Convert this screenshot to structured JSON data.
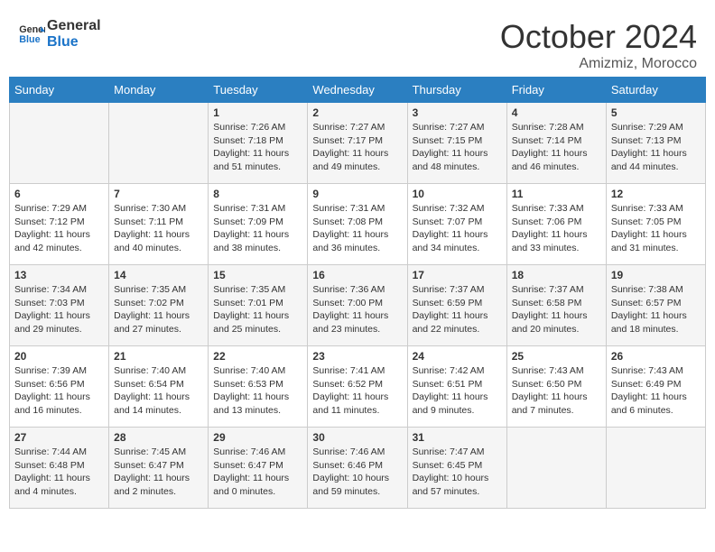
{
  "header": {
    "logo_line1": "General",
    "logo_line2": "Blue",
    "month_title": "October 2024",
    "subtitle": "Amizmiz, Morocco"
  },
  "days_of_week": [
    "Sunday",
    "Monday",
    "Tuesday",
    "Wednesday",
    "Thursday",
    "Friday",
    "Saturday"
  ],
  "weeks": [
    [
      {
        "day": "",
        "sunrise": "",
        "sunset": "",
        "daylight": ""
      },
      {
        "day": "",
        "sunrise": "",
        "sunset": "",
        "daylight": ""
      },
      {
        "day": "1",
        "sunrise": "Sunrise: 7:26 AM",
        "sunset": "Sunset: 7:18 PM",
        "daylight": "Daylight: 11 hours and 51 minutes."
      },
      {
        "day": "2",
        "sunrise": "Sunrise: 7:27 AM",
        "sunset": "Sunset: 7:17 PM",
        "daylight": "Daylight: 11 hours and 49 minutes."
      },
      {
        "day": "3",
        "sunrise": "Sunrise: 7:27 AM",
        "sunset": "Sunset: 7:15 PM",
        "daylight": "Daylight: 11 hours and 48 minutes."
      },
      {
        "day": "4",
        "sunrise": "Sunrise: 7:28 AM",
        "sunset": "Sunset: 7:14 PM",
        "daylight": "Daylight: 11 hours and 46 minutes."
      },
      {
        "day": "5",
        "sunrise": "Sunrise: 7:29 AM",
        "sunset": "Sunset: 7:13 PM",
        "daylight": "Daylight: 11 hours and 44 minutes."
      }
    ],
    [
      {
        "day": "6",
        "sunrise": "Sunrise: 7:29 AM",
        "sunset": "Sunset: 7:12 PM",
        "daylight": "Daylight: 11 hours and 42 minutes."
      },
      {
        "day": "7",
        "sunrise": "Sunrise: 7:30 AM",
        "sunset": "Sunset: 7:11 PM",
        "daylight": "Daylight: 11 hours and 40 minutes."
      },
      {
        "day": "8",
        "sunrise": "Sunrise: 7:31 AM",
        "sunset": "Sunset: 7:09 PM",
        "daylight": "Daylight: 11 hours and 38 minutes."
      },
      {
        "day": "9",
        "sunrise": "Sunrise: 7:31 AM",
        "sunset": "Sunset: 7:08 PM",
        "daylight": "Daylight: 11 hours and 36 minutes."
      },
      {
        "day": "10",
        "sunrise": "Sunrise: 7:32 AM",
        "sunset": "Sunset: 7:07 PM",
        "daylight": "Daylight: 11 hours and 34 minutes."
      },
      {
        "day": "11",
        "sunrise": "Sunrise: 7:33 AM",
        "sunset": "Sunset: 7:06 PM",
        "daylight": "Daylight: 11 hours and 33 minutes."
      },
      {
        "day": "12",
        "sunrise": "Sunrise: 7:33 AM",
        "sunset": "Sunset: 7:05 PM",
        "daylight": "Daylight: 11 hours and 31 minutes."
      }
    ],
    [
      {
        "day": "13",
        "sunrise": "Sunrise: 7:34 AM",
        "sunset": "Sunset: 7:03 PM",
        "daylight": "Daylight: 11 hours and 29 minutes."
      },
      {
        "day": "14",
        "sunrise": "Sunrise: 7:35 AM",
        "sunset": "Sunset: 7:02 PM",
        "daylight": "Daylight: 11 hours and 27 minutes."
      },
      {
        "day": "15",
        "sunrise": "Sunrise: 7:35 AM",
        "sunset": "Sunset: 7:01 PM",
        "daylight": "Daylight: 11 hours and 25 minutes."
      },
      {
        "day": "16",
        "sunrise": "Sunrise: 7:36 AM",
        "sunset": "Sunset: 7:00 PM",
        "daylight": "Daylight: 11 hours and 23 minutes."
      },
      {
        "day": "17",
        "sunrise": "Sunrise: 7:37 AM",
        "sunset": "Sunset: 6:59 PM",
        "daylight": "Daylight: 11 hours and 22 minutes."
      },
      {
        "day": "18",
        "sunrise": "Sunrise: 7:37 AM",
        "sunset": "Sunset: 6:58 PM",
        "daylight": "Daylight: 11 hours and 20 minutes."
      },
      {
        "day": "19",
        "sunrise": "Sunrise: 7:38 AM",
        "sunset": "Sunset: 6:57 PM",
        "daylight": "Daylight: 11 hours and 18 minutes."
      }
    ],
    [
      {
        "day": "20",
        "sunrise": "Sunrise: 7:39 AM",
        "sunset": "Sunset: 6:56 PM",
        "daylight": "Daylight: 11 hours and 16 minutes."
      },
      {
        "day": "21",
        "sunrise": "Sunrise: 7:40 AM",
        "sunset": "Sunset: 6:54 PM",
        "daylight": "Daylight: 11 hours and 14 minutes."
      },
      {
        "day": "22",
        "sunrise": "Sunrise: 7:40 AM",
        "sunset": "Sunset: 6:53 PM",
        "daylight": "Daylight: 11 hours and 13 minutes."
      },
      {
        "day": "23",
        "sunrise": "Sunrise: 7:41 AM",
        "sunset": "Sunset: 6:52 PM",
        "daylight": "Daylight: 11 hours and 11 minutes."
      },
      {
        "day": "24",
        "sunrise": "Sunrise: 7:42 AM",
        "sunset": "Sunset: 6:51 PM",
        "daylight": "Daylight: 11 hours and 9 minutes."
      },
      {
        "day": "25",
        "sunrise": "Sunrise: 7:43 AM",
        "sunset": "Sunset: 6:50 PM",
        "daylight": "Daylight: 11 hours and 7 minutes."
      },
      {
        "day": "26",
        "sunrise": "Sunrise: 7:43 AM",
        "sunset": "Sunset: 6:49 PM",
        "daylight": "Daylight: 11 hours and 6 minutes."
      }
    ],
    [
      {
        "day": "27",
        "sunrise": "Sunrise: 7:44 AM",
        "sunset": "Sunset: 6:48 PM",
        "daylight": "Daylight: 11 hours and 4 minutes."
      },
      {
        "day": "28",
        "sunrise": "Sunrise: 7:45 AM",
        "sunset": "Sunset: 6:47 PM",
        "daylight": "Daylight: 11 hours and 2 minutes."
      },
      {
        "day": "29",
        "sunrise": "Sunrise: 7:46 AM",
        "sunset": "Sunset: 6:47 PM",
        "daylight": "Daylight: 11 hours and 0 minutes."
      },
      {
        "day": "30",
        "sunrise": "Sunrise: 7:46 AM",
        "sunset": "Sunset: 6:46 PM",
        "daylight": "Daylight: 10 hours and 59 minutes."
      },
      {
        "day": "31",
        "sunrise": "Sunrise: 7:47 AM",
        "sunset": "Sunset: 6:45 PM",
        "daylight": "Daylight: 10 hours and 57 minutes."
      },
      {
        "day": "",
        "sunrise": "",
        "sunset": "",
        "daylight": ""
      },
      {
        "day": "",
        "sunrise": "",
        "sunset": "",
        "daylight": ""
      }
    ]
  ]
}
